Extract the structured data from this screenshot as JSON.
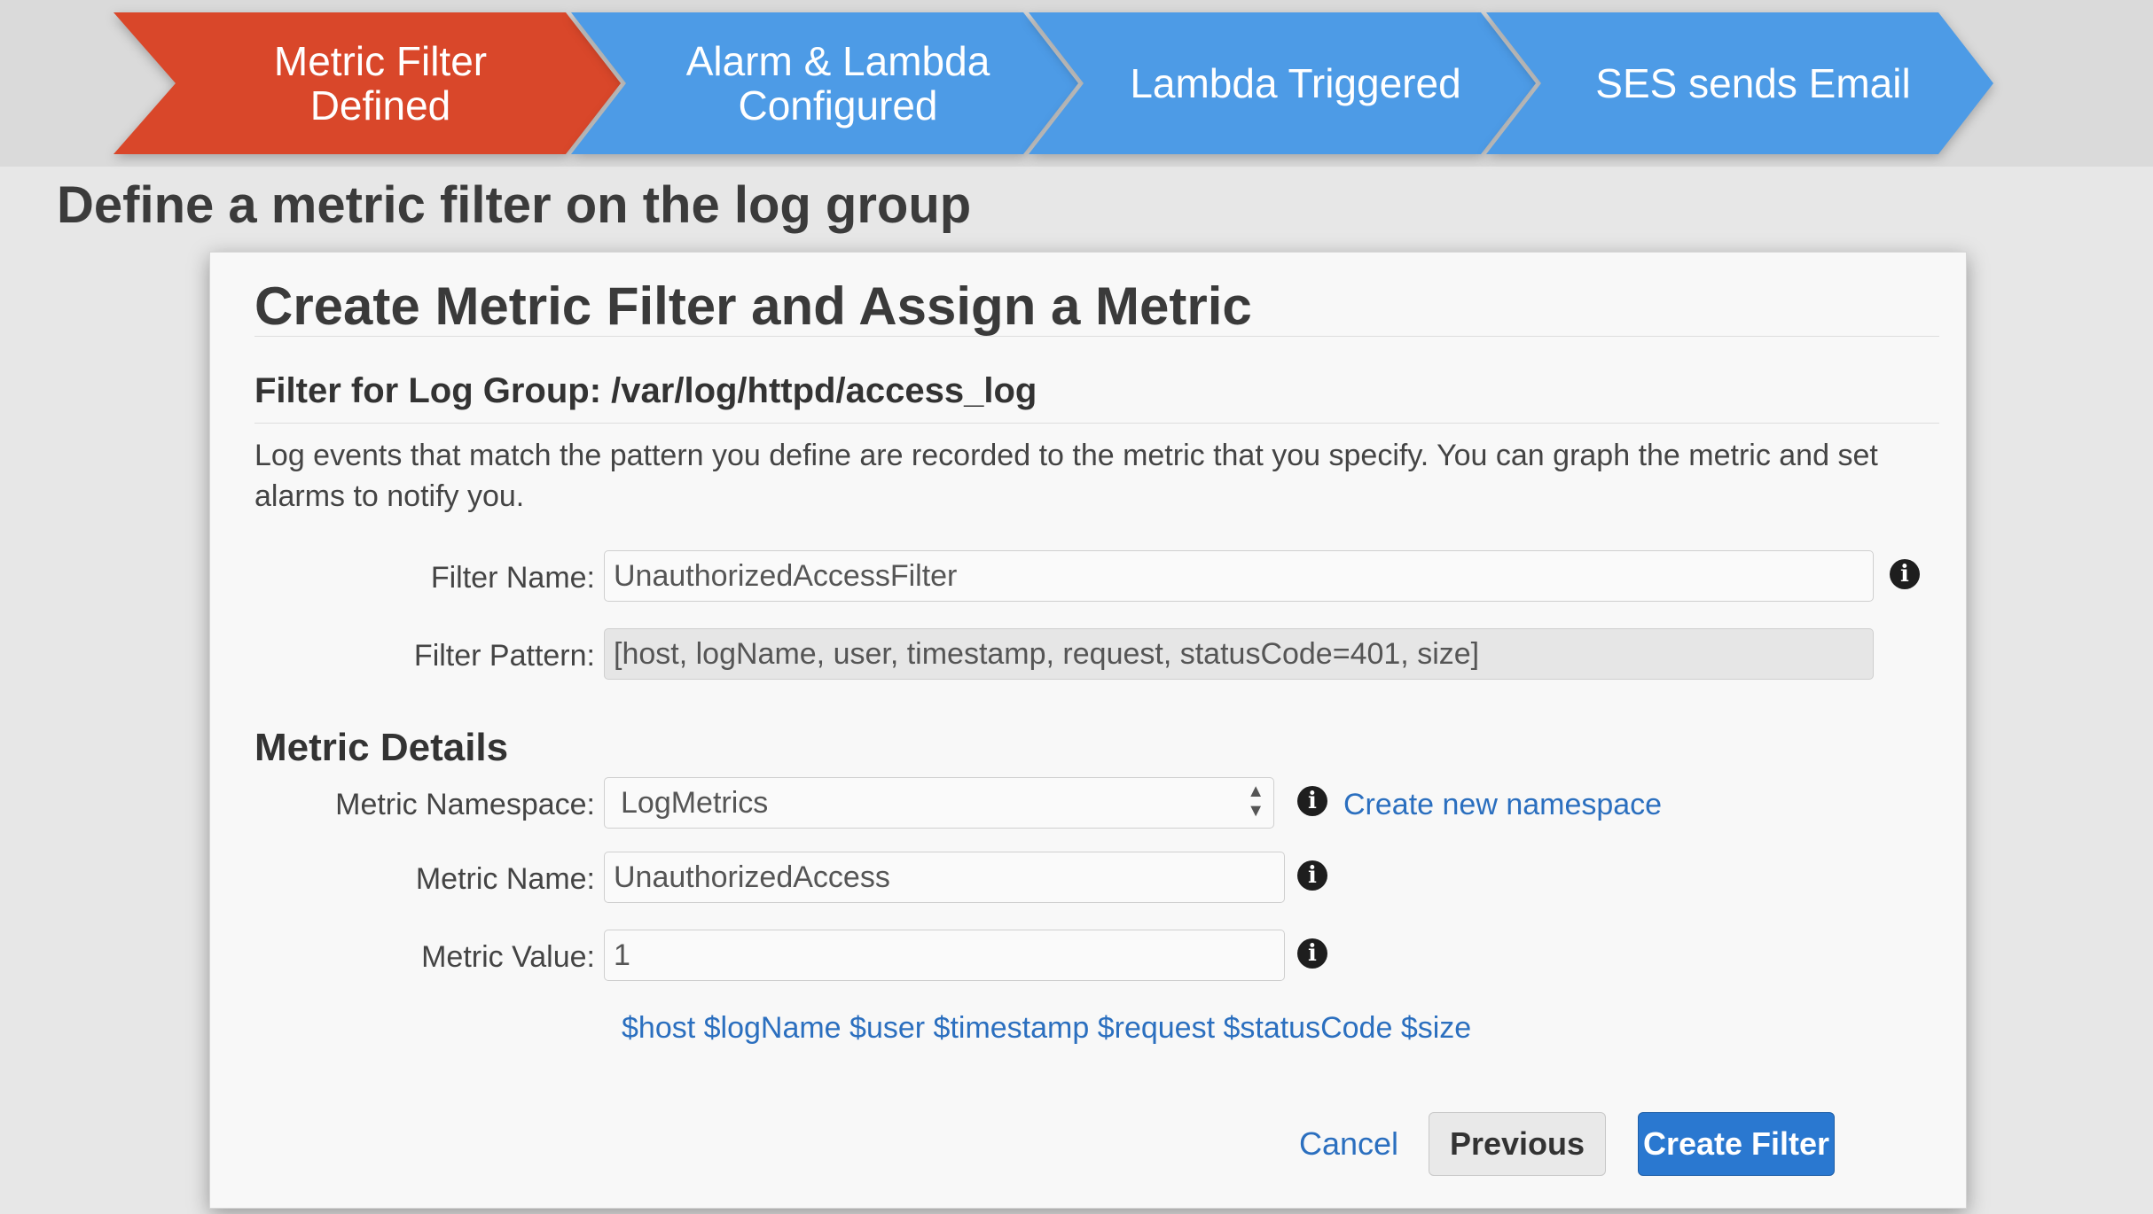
{
  "banner": {
    "steps": [
      {
        "label": "Metric Filter\nDefined",
        "color": "#d9472a"
      },
      {
        "label": "Alarm & Lambda\nConfigured",
        "color": "#4d9be6"
      },
      {
        "label": "Lambda Triggered",
        "color": "#4d9be6"
      },
      {
        "label": "SES sends Email",
        "color": "#4d9be6"
      }
    ]
  },
  "page_heading": "Define a metric filter on the log group",
  "dialog": {
    "title": "Create Metric Filter and Assign a Metric",
    "filter_section_title": "Filter for Log Group: /var/log/httpd/access_log",
    "description": "Log events that match the pattern you define are recorded to the metric that you specify. You can graph the metric and set alarms to notify you.",
    "filter_name": {
      "label": "Filter Name:",
      "value": "UnauthorizedAccessFilter"
    },
    "filter_pattern": {
      "label": "Filter Pattern:",
      "value": "[host, logName, user, timestamp, request, statusCode=401, size]"
    },
    "metric_details_title": "Metric Details",
    "metric_namespace": {
      "label": "Metric Namespace:",
      "value": "LogMetrics",
      "link": "Create new namespace"
    },
    "metric_name": {
      "label": "Metric Name:",
      "value": "UnauthorizedAccess"
    },
    "metric_value": {
      "label": "Metric Value:",
      "value": "1"
    },
    "variables": "$host $logName $user $timestamp $request $statusCode $size",
    "buttons": {
      "cancel": "Cancel",
      "previous": "Previous",
      "create": "Create Filter"
    }
  },
  "icons": {
    "info": "info-icon",
    "select_arrows": "select-arrows-icon"
  },
  "colors": {
    "active_step": "#d9472a",
    "inactive_step": "#4d9be6",
    "link": "#2b6fbf",
    "primary_button": "#2a78d0"
  }
}
